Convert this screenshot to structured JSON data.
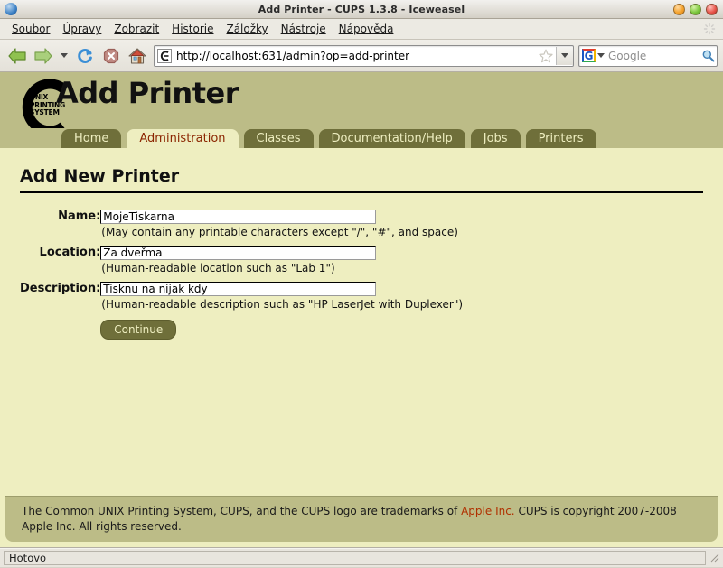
{
  "window": {
    "title": "Add Printer - CUPS 1.3.8 - Iceweasel",
    "buttons": {
      "minimize": "minimize",
      "maximize": "maximize",
      "close": "close"
    }
  },
  "menubar": {
    "items": [
      {
        "label": "Soubor"
      },
      {
        "label": "Úpravy"
      },
      {
        "label": "Zobrazit"
      },
      {
        "label": "Historie"
      },
      {
        "label": "Záložky"
      },
      {
        "label": "Nástroje"
      },
      {
        "label": "Nápověda"
      }
    ]
  },
  "toolbar": {
    "back": "Back",
    "forward": "Forward",
    "history_dropdown": "Recent pages",
    "reload": "Reload",
    "stop": "Stop",
    "home": "Home",
    "url": "http://localhost:631/admin?op=add-printer",
    "bookmark_star": "Bookmark this page",
    "url_dropdown": "Show history",
    "search_engine": "G",
    "search_placeholder": "Google",
    "search_go": "Search"
  },
  "page": {
    "title": "Add Printer",
    "logo_lines": [
      "UNIX",
      "PRINTING",
      "SYSTEM"
    ],
    "tabs": [
      {
        "label": "Home",
        "active": false
      },
      {
        "label": "Administration",
        "active": true
      },
      {
        "label": "Classes",
        "active": false
      },
      {
        "label": "Documentation/Help",
        "active": false
      },
      {
        "label": "Jobs",
        "active": false
      },
      {
        "label": "Printers",
        "active": false
      }
    ],
    "heading": "Add New Printer",
    "fields": [
      {
        "label": "Name:",
        "value": "MojeTiskarna",
        "hint": "(May contain any printable characters except \"/\", \"#\", and space)"
      },
      {
        "label": "Location:",
        "value": "Za dveřma",
        "hint": "(Human-readable location such as \"Lab 1\")"
      },
      {
        "label": "Description:",
        "value": "Tisknu na nijak kdy",
        "hint": "(Human-readable description such as \"HP LaserJet with Duplexer\")"
      }
    ],
    "submit_label": "Continue",
    "footer": {
      "text_before": "The Common UNIX Printing System, CUPS, and the CUPS logo are trademarks of ",
      "link": "Apple Inc.",
      "text_after": " CUPS is copyright 2007-2008 Apple Inc. All rights reserved."
    }
  },
  "statusbar": {
    "text": "Hotovo"
  },
  "colors": {
    "page_bg": "#eeeec0",
    "band": "#bcbc87",
    "tab_inactive": "#6f6f3a",
    "tab_active_text": "#8b2500",
    "link": "#b03000"
  }
}
